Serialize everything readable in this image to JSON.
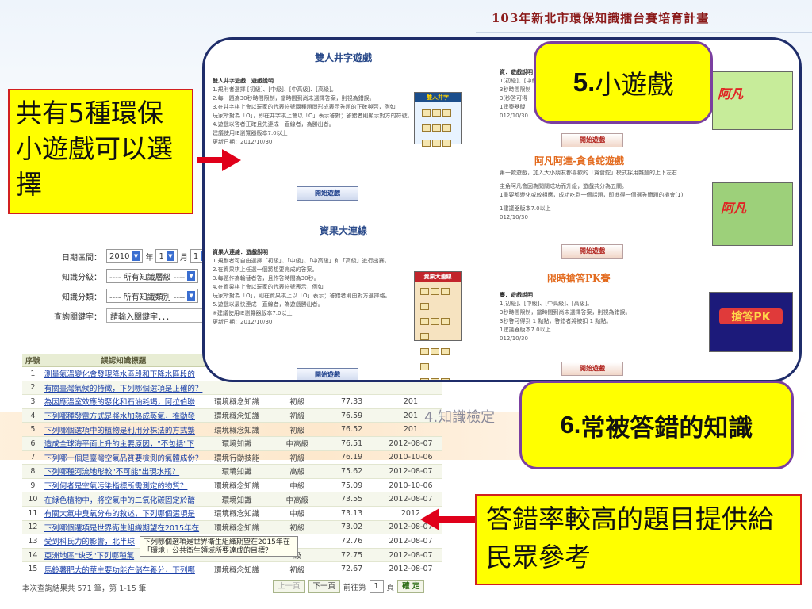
{
  "slide": {
    "title": "103年新北市環保知識擂台賽培育計畫"
  },
  "search_form": {
    "date_label": "日期區間：",
    "date_year": "2010",
    "date_year_unit": "年",
    "date_month": "1",
    "date_month_unit": "月",
    "date_day": "1",
    "level_label": "知識分級：",
    "level_value": "---- 所有知識層級 ----",
    "category_label": "知識分類：",
    "category_value": "---- 所有知識類別 ----",
    "keyword_label": "查詢關鍵字：",
    "keyword_placeholder": "請輸入關鍵字．．．"
  },
  "table": {
    "headers": [
      "序號",
      "誤認知識標題",
      "",
      "",
      "",
      ""
    ],
    "rows": [
      {
        "n": "1",
        "q": "測量氣溫變化會發現降水區段和下降水區段的",
        "cat": "",
        "lvl": "",
        "rate": "",
        "date": ""
      },
      {
        "n": "2",
        "q": "有關臺灣氣候的特徵，下列哪個選項是正確的？",
        "cat": "",
        "lvl": "",
        "rate": "",
        "date": ""
      },
      {
        "n": "3",
        "q": "為因應溫室效應的惡化和石油耗竭，阿拉伯聯",
        "cat": "環境概念知識",
        "lvl": "初級",
        "rate": "77.33",
        "date": "201"
      },
      {
        "n": "4",
        "q": "下列哪種發電方式是將水加熱成蒸氣，推動發",
        "cat": "環境概念知識",
        "lvl": "初級",
        "rate": "76.59",
        "date": "201"
      },
      {
        "n": "5",
        "q": "下列哪個選項中的植物是利用分株法的方式繁",
        "cat": "環境概念知識",
        "lvl": "初級",
        "rate": "76.52",
        "date": "201"
      },
      {
        "n": "6",
        "q": "造成全球海平面上升的主要原因，\"不包括\"下",
        "cat": "環境知識",
        "lvl": "中高級",
        "rate": "76.51",
        "date": "2012-08-07"
      },
      {
        "n": "7",
        "q": "下列哪一個是臺灣空氣品質要檢測的氣體成份？",
        "cat": "環境行動技能",
        "lvl": "初級",
        "rate": "76.19",
        "date": "2010-10-06"
      },
      {
        "n": "8",
        "q": "下列哪種河流地形較\"不可能\"出現水瓶？",
        "cat": "環境知識",
        "lvl": "高級",
        "rate": "75.62",
        "date": "2012-08-07"
      },
      {
        "n": "9",
        "q": "下列何者是空氣污染指標所需測定的物質？",
        "cat": "環境概念知識",
        "lvl": "中級",
        "rate": "75.09",
        "date": "2010-10-06"
      },
      {
        "n": "10",
        "q": "在綠色植物中，將空氣中的二氧化碳固定於醣",
        "cat": "環境知識",
        "lvl": "中高級",
        "rate": "73.55",
        "date": "2012-08-07"
      },
      {
        "n": "11",
        "q": "有關大氣中臭氧分布的敘述，下列哪個選項是",
        "cat": "環境概念知識",
        "lvl": "中級",
        "rate": "73.13",
        "date": "2012"
      },
      {
        "n": "12",
        "q": "下列哪個選項是世界衛生組織期望在2015年在",
        "cat": "環境概念知識",
        "lvl": "初級",
        "rate": "73.02",
        "date": "2012-08-07"
      },
      {
        "n": "13",
        "q": "受到科氏力的影響，北半球",
        "cat": "",
        "lvl": "",
        "rate": "72.76",
        "date": "2012-08-07"
      },
      {
        "n": "14",
        "q": "亞洲地區\"缺乏\"下列哪種氣",
        "cat": "",
        "lvl": "級",
        "rate": "72.75",
        "date": "2012-08-07"
      },
      {
        "n": "15",
        "q": "馬鈴薯肥大的莖主要功能在儲存養分，下列哪",
        "cat": "環境概念知識",
        "lvl": "初級",
        "rate": "72.67",
        "date": "2012-08-07"
      }
    ],
    "tooltip": "下列哪個選項是世界衛生組織期望在2015年在「環境」公共衛生領域所要達成的目標？"
  },
  "footer": {
    "count": "本次查詢結果共 571 筆，第 1-15 筆",
    "prev": "上一頁",
    "next": "下一頁",
    "goto_prefix": "前往第",
    "page": "1",
    "goto_suffix": "頁",
    "confirm": "確 定"
  },
  "games": [
    {
      "title": "雙人井字遊戲",
      "heading": "雙人井字遊戲．遊戲說明",
      "lines": [
        "1.規則者選擇 [初級]、[中級]、[中高級]、[高級]。",
        "2.每一題為30秒時間限制，當時間到尚未選擇答案，則視為錯誤。",
        "3.在井字棋上會以玩家的代表符號兩種題問形成表示答題的正確與否，例如",
        "玩家所對為「O」，即在井字棋上會以「O」表示答對；答錯者則顯示對方的符號。",
        "4.遊戲以答者正確且先連成一直線者，為勝出者。",
        "建議使用IE瀏覽器版本7.0以上"
      ],
      "date": "更新日期：2012/10/30",
      "play": "開始遊戲"
    },
    {
      "title": "資果大連線",
      "heading": "資果大連線．遊戲說明",
      "lines": [
        "1.規劃者可自由選擇「初級」、「中級」、「中高級」和「高級」進行出賽。",
        "2.在資果棋上任選一個將想要完成的答案。",
        "3.每題作為輪替者答，且作答時間為30秒。",
        "4.在資果棋上會以玩家的代表符號表示，例如",
        "玩家所對為「O」，則在資果棋上以「O」表示；答錯者則由對方選擇格。",
        "5.遊戲以最快連成一直線者，為遊戲勝出者。",
        "※建議使用IE瀏覽器版本7.0以上"
      ],
      "date": "更新日期：2012/10/30",
      "play": "開始遊戲"
    },
    {
      "title": "",
      "heading": "資．遊戲說明",
      "lines": [
        "1[初級]、[中級]、",
        "3秒時間限制",
        "3(秒答可得",
        "1建築器版",
        "012/10/30"
      ],
      "date": "",
      "play": "開始遊戲",
      "thumb_text": "阿凡"
    },
    {
      "title": "阿凡阿達-貪食蛇遊戲",
      "heading": "",
      "lines": [
        "第一款遊戲，加入大小朋友都喜歡的「貪食蛇」模式採用雜題的上下左右",
        "主角阿凡會因為闖關成功而升級，遊戲共分為五關。",
        "1重要都變化或較相應，成功吃到一個話題，即進得一個選答簡題的機會(1)",
        "1建議器版本7.0以上",
        "012/10/30"
      ],
      "date": "",
      "play": "開始遊戲",
      "thumb_text": "阿凡"
    },
    {
      "title": "限時搶答PK賽",
      "heading": "賽．遊戲說明",
      "lines": [
        "1[初級]、[中級]、[中高級]、[高級]。",
        "3秒時間限制，當時間到尚未選擇答案，則視為錯誤。",
        "3秒答可得到 1 點點，答錯者將被扣 1 點點。",
        "1建議器版本7.0以上",
        "012/10/30"
      ],
      "date": "",
      "play": "開始遊戲",
      "thumb_text": "搶答PK"
    }
  ],
  "callouts": {
    "left": "共有5種環保小遊戲可以選擇",
    "top_pill_num": "5.",
    "top_pill_text": "小遊戲",
    "bottom_pill_num": "6.",
    "bottom_pill_text": "常被答錯的知識",
    "knowledge_label": "4.知識檢定",
    "bottom": "答錯率較高的題目提供給民眾參考"
  },
  "colors": {
    "callout_bg": "#ffff00",
    "callout_border": "#d12020",
    "pill_border": "#7b3fa0",
    "panel_border": "#1f2d6a",
    "arrow": "#e0001a"
  }
}
